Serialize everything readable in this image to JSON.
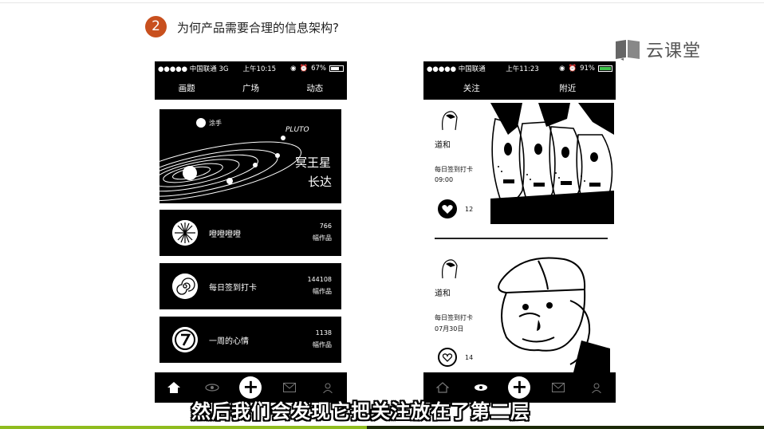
{
  "slide": {
    "number": "2",
    "heading": "为何产品需要合理的信息架构?",
    "brand": "云课堂",
    "caption": "然后我们会发现它把关注放在了第二层"
  },
  "left_phone": {
    "status": {
      "carrier": "●●●●● 中国联通  3G",
      "time": "上午10:15",
      "battery": "67%"
    },
    "tabs": [
      "画题",
      "广场",
      "动态"
    ],
    "active_tab": 0,
    "banner": {
      "logo_text": "涂手",
      "handwriting": "PLUTO",
      "title_art": "冥王星",
      "subtitle_art": "长达"
    },
    "cards": [
      {
        "title": "噔噔噔噔",
        "count": "766",
        "unit": "幅作品",
        "icon": "starburst-icon"
      },
      {
        "title": "每日签到打卡",
        "count": "144108",
        "unit": "幅作品",
        "icon": "spiral-icon"
      },
      {
        "title": "一周的心情",
        "count": "1138",
        "unit": "幅作品",
        "icon": "seven-icon"
      }
    ],
    "toolbar": [
      "home-icon",
      "eye-icon",
      "plus-icon",
      "mail-icon",
      "person-icon"
    ],
    "toolbar_active": 0
  },
  "right_phone": {
    "status": {
      "carrier": "●●●●● 中国联通",
      "time": "上午11:23",
      "battery": "91%"
    },
    "tabs": [
      "关注",
      "附近"
    ],
    "active_tab": 0,
    "posts": [
      {
        "user": "道和",
        "activity": "每日签到打卡",
        "time": "09:00",
        "likes": "12"
      },
      {
        "user": "道和",
        "activity": "每日签到打卡",
        "time": "07月30日",
        "likes": "14"
      }
    ],
    "toolbar": [
      "home-icon",
      "eye-icon",
      "plus-icon",
      "mail-icon",
      "person-icon"
    ],
    "toolbar_active": 1
  },
  "colors": {
    "badge": "#c8501e",
    "accent_bar": "#8fbc1f",
    "battery_green": "#3ec34a"
  }
}
